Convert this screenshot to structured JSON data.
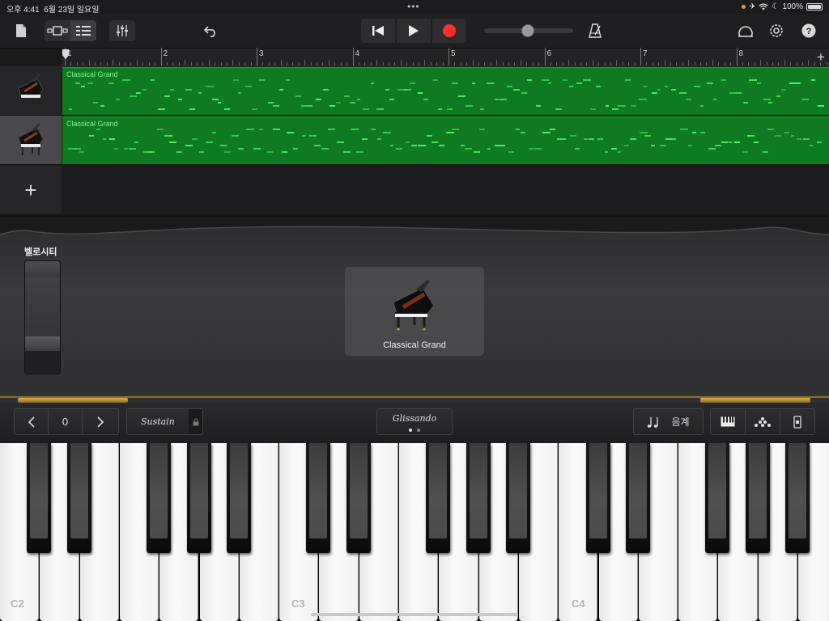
{
  "status_bar": {
    "time": "오후 4:41",
    "date": "6월 23일 일요일",
    "battery": "100%",
    "dots": "•••"
  },
  "toolbar": {
    "buttons": [
      "my-songs",
      "browser-view",
      "tracks-view",
      "mixer",
      "undo",
      "rewind",
      "play",
      "record",
      "metronome",
      "loop-browser",
      "settings",
      "help"
    ]
  },
  "ruler": {
    "bars": [
      "1",
      "2",
      "3",
      "4",
      "5",
      "6",
      "7",
      "8"
    ],
    "add_label": "+"
  },
  "tracks": [
    {
      "name": "Classical Grand",
      "active": false
    },
    {
      "name": "Classical Grand",
      "active": true
    }
  ],
  "add_track_label": "+",
  "instrument": {
    "velocity_label": "벨로시티",
    "name": "Classical Grand"
  },
  "controls": {
    "octave_value": "0",
    "sustain_label": "Sustain",
    "glissando_label": "Glissando",
    "scale_label": "음계"
  },
  "keyboard": {
    "labels": [
      "C2",
      "C3",
      "C4"
    ]
  },
  "colors": {
    "region_green": "#0e7a22",
    "note_green": "#4ef36a",
    "record_red": "#ff2d2d",
    "gold": "#8a6d2a"
  }
}
